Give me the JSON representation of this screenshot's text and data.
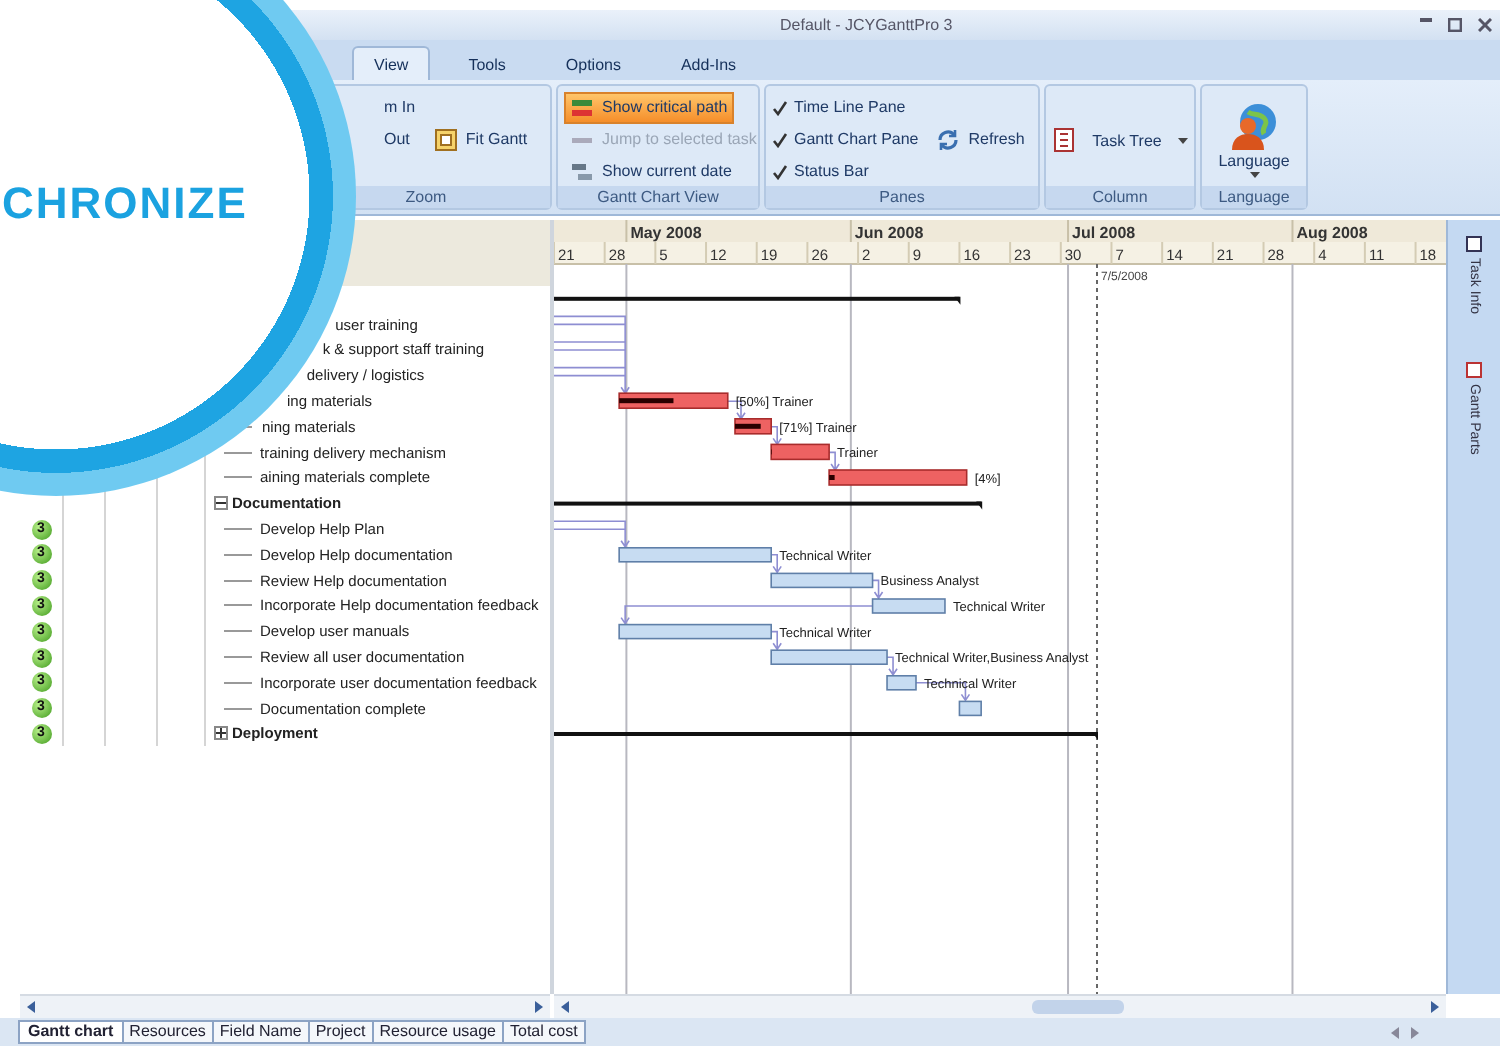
{
  "window": {
    "title": "Default - JCYGanttPro 3"
  },
  "overlay": {
    "title": "CHRONIZE"
  },
  "ribbon_tabs": [
    {
      "label": "View",
      "selected": true
    },
    {
      "label": "Tools",
      "selected": false
    },
    {
      "label": "Options",
      "selected": false
    },
    {
      "label": "Add-Ins",
      "selected": false
    }
  ],
  "ribbon_groups": [
    {
      "label": "Zoom",
      "rows": [
        [
          {
            "kind": "plain",
            "label": "m In"
          }
        ],
        [
          {
            "kind": "plain",
            "label": "Out"
          },
          {
            "kind": "fit",
            "label": "Fit Gantt"
          }
        ]
      ]
    },
    {
      "label": "Gantt Chart View",
      "rows": [
        [
          {
            "kind": "critical",
            "label": "Show critical path",
            "selected": true,
            "disabled": false
          }
        ],
        [
          {
            "kind": "jump",
            "label": "Jump to selected task",
            "selected": false,
            "disabled": true
          }
        ],
        [
          {
            "kind": "today",
            "label": "Show current date",
            "selected": false,
            "disabled": false
          }
        ]
      ]
    },
    {
      "label": "Panes",
      "rows": [
        [
          {
            "kind": "check",
            "label": "Time Line Pane",
            "checked": true
          }
        ],
        [
          {
            "kind": "check",
            "label": "Gantt Chart Pane",
            "checked": true
          },
          {
            "kind": "refresh",
            "label": "Refresh"
          }
        ],
        [
          {
            "kind": "check",
            "label": "Status Bar",
            "checked": true
          }
        ]
      ]
    },
    {
      "label": "Column",
      "rows": [
        [
          {
            "kind": "tree",
            "label": "Task Tree"
          }
        ]
      ]
    },
    {
      "label": "Language",
      "rows": [
        [
          {
            "kind": "language",
            "label": "Language"
          }
        ]
      ]
    }
  ],
  "timeline": {
    "months": [
      "May 2008",
      "Jun 2008",
      "Jul 2008",
      "Aug 2008"
    ],
    "days": [
      "21",
      "28",
      "5",
      "12",
      "19",
      "26",
      "2",
      "9",
      "16",
      "23",
      "30",
      "7",
      "14",
      "21",
      "28",
      "4",
      "11",
      "18"
    ],
    "current_date": "7/5/2008"
  },
  "rows": [
    {
      "kind": "summary"
    },
    {
      "kind": "task",
      "name": "user training"
    },
    {
      "kind": "task",
      "name": "k & support staff training"
    },
    {
      "kind": "task",
      "name": "delivery / logistics"
    },
    {
      "kind": "critical",
      "name": "ing materials",
      "level": 0.5,
      "label": "[50%] Trainer"
    },
    {
      "kind": "critical",
      "name": "ning materials",
      "level": 0.71,
      "label": "[71%] Trainer"
    },
    {
      "kind": "critical",
      "name": "training delivery mechanism",
      "level": 0,
      "label": "Trainer"
    },
    {
      "kind": "critical",
      "name": "aining materials complete",
      "level": 0.04,
      "label": "[4%]"
    },
    {
      "kind": "summary",
      "name": "Documentation",
      "expanded": true
    },
    {
      "kind": "task",
      "name": "Develop Help Plan",
      "badge": "3"
    },
    {
      "kind": "task",
      "name": "Develop Help documentation",
      "badge": "3",
      "label": "Technical Writer"
    },
    {
      "kind": "task",
      "name": "Review Help documentation",
      "badge": "3",
      "label": "Business Analyst"
    },
    {
      "kind": "task",
      "name": "Incorporate Help documentation feedback",
      "badge": "3",
      "label": "Technical Writer"
    },
    {
      "kind": "task",
      "name": "Develop user manuals",
      "badge": "3",
      "label": "Technical Writer"
    },
    {
      "kind": "task",
      "name": "Review all user documentation",
      "badge": "3",
      "label": "Technical Writer,Business Analyst"
    },
    {
      "kind": "task",
      "name": "Incorporate user documentation feedback",
      "badge": "3",
      "label": "Technical Writer"
    },
    {
      "kind": "task",
      "name": "Documentation complete",
      "badge": "3"
    },
    {
      "kind": "summary",
      "name": "Deployment",
      "expanded": false,
      "badge": "3"
    }
  ],
  "side_tabs": [
    "Task Info",
    "Gantt Parts"
  ],
  "sheet_tabs": [
    {
      "label": "Gantt chart",
      "selected": true
    },
    {
      "label": "Resources",
      "selected": false
    },
    {
      "label": "Field Name",
      "selected": false
    },
    {
      "label": "Project",
      "selected": false
    },
    {
      "label": "Resource usage",
      "selected": false
    },
    {
      "label": "Total cost",
      "selected": false
    }
  ]
}
